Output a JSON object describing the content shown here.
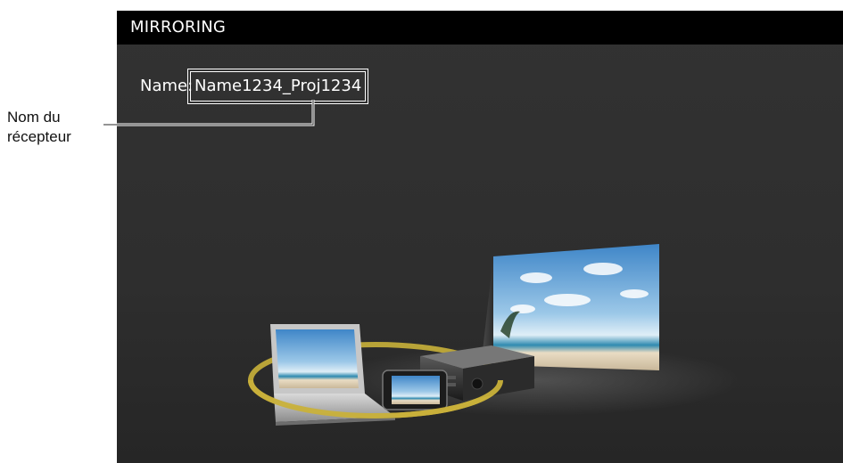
{
  "window": {
    "title": "MIRRORING"
  },
  "receiver": {
    "name_label": "Name:",
    "name_value": "Name1234_Proj1234"
  },
  "annotation": {
    "line1": "Nom du",
    "line2": "récepteur"
  },
  "illustration": {
    "icons": [
      "laptop-icon",
      "smartphone-icon",
      "projector-icon",
      "projection-screen-icon",
      "connection-ring-icon"
    ]
  },
  "colors": {
    "titlebar": "#000000",
    "background": "#2f2f2f",
    "text": "#ffffff",
    "ring": "#c9b13a"
  }
}
